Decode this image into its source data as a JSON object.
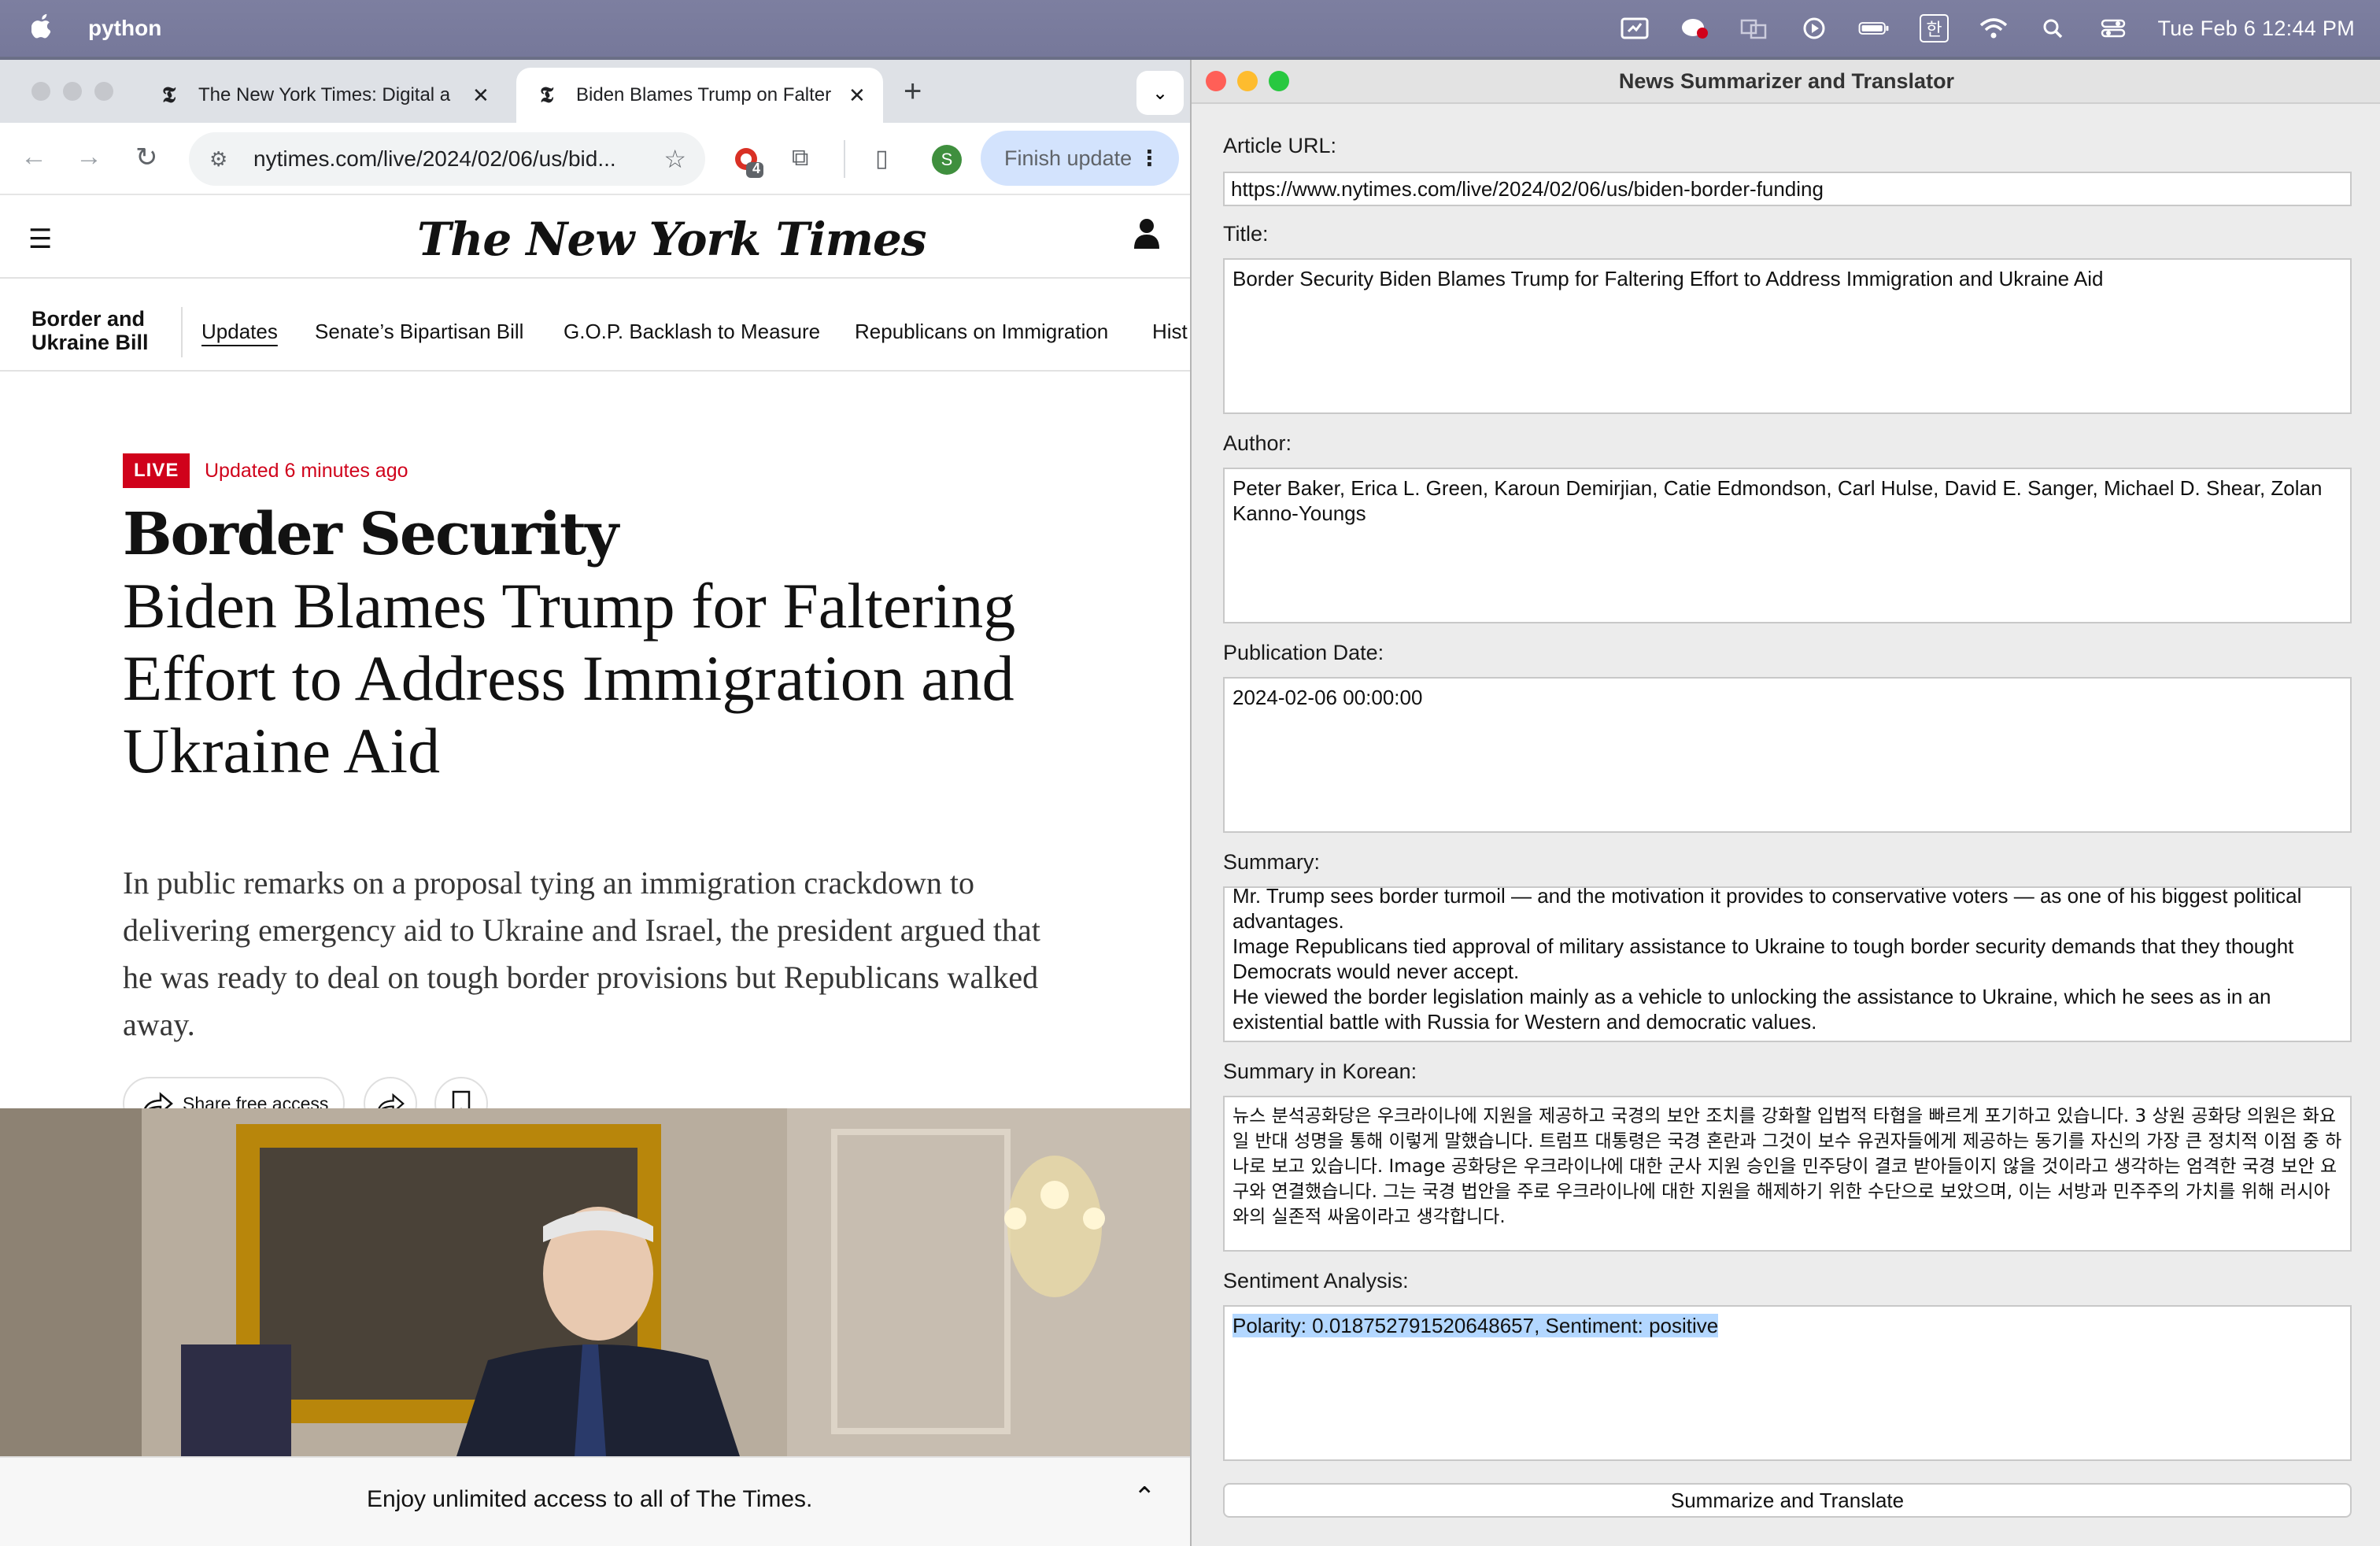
{
  "menubar": {
    "app_name": "python",
    "clock": "Tue Feb 6  12:44 PM",
    "input_source": "한"
  },
  "browser": {
    "tabs": [
      {
        "title": "The New York Times: Digital a",
        "favicon": "𝕿"
      },
      {
        "title": "Biden Blames Trump on Falter",
        "favicon": "𝕿"
      }
    ],
    "url": "nytimes.com/live/2024/02/06/us/bid...",
    "extension_badge": "4",
    "profile_initial": "S",
    "finish_update_label": "Finish update"
  },
  "nyt": {
    "logo": "The New York Times",
    "section": "Border and Ukraine Bill",
    "subnav": [
      "Updates",
      "Senate’s Bipartisan Bill",
      "G.O.P. Backlash to Measure",
      "Republicans on Immigration",
      "Hist"
    ],
    "live_label": "LIVE",
    "updated": "Updated 6 minutes ago",
    "kicker": "Border Security",
    "headline": "Biden Blames Trump for Faltering Effort to Address Immigration and Ukraine Aid",
    "dek": "In public remarks on a proposal tying an immigration crackdown to delivering emergency aid to Ukraine and Israel, the president argued that he was ready to deal on tough border provisions but Republicans walked away.",
    "share_free_label": "Share free access",
    "paywall_text": "Enjoy unlimited access to all of The Times."
  },
  "app": {
    "window_title": "News Summarizer and Translator",
    "url_label": "Article URL:",
    "url_value": "https://www.nytimes.com/live/2024/02/06/us/biden-border-funding",
    "title_label": "Title:",
    "title_value": "Border Security Biden Blames Trump for Faltering Effort to Address Immigration and Ukraine Aid",
    "author_label": "Author:",
    "author_value": "Peter Baker, Erica L. Green, Karoun Demirjian, Catie Edmondson, Carl Hulse, David E. Sanger, Michael D. Shear, Zolan Kanno-Youngs",
    "date_label": "Publication Date:",
    "date_value": "2024-02-06 00:00:00",
    "summary_label": "Summary:",
    "summary_lines": [
      "Mr. Trump sees border turmoil — and the motivation it provides to conservative voters — as one of his biggest political advantages.",
      "Image Republicans tied approval of military assistance to Ukraine to tough border security demands that they thought Democrats would never accept.",
      "He viewed the border legislation mainly as a vehicle to unlocking the assistance to Ukraine, which he sees as in an existential battle with Russia for Western and democratic values."
    ],
    "korean_label": "Summary in Korean:",
    "korean_value": "뉴스 분석공화당은 우크라이나에 지원을 제공하고 국경의 보안 조치를 강화할 입법적 타협을 빠르게 포기하고 있습니다. 3 상원 공화당 의원은 화요일 반대 성명을 통해 이렇게 말했습니다. 트럼프 대통령은 국경 혼란과 그것이 보수 유권자들에게 제공하는 동기를 자신의 가장 큰 정치적 이점 중 하나로 보고 있습니다. Image 공화당은 우크라이나에 대한 군사 지원 승인을 민주당이 결코 받아들이지 않을 것이라고 생각하는 엄격한 국경 보안 요구와 연결했습니다. 그는 국경 법안을 주로 우크라이나에 대한 지원을 해제하기 위한 수단으로 보았으며, 이는 서방과 민주주의 가치를 위해 러시아와의 실존적 싸움이라고 생각합니다.",
    "sentiment_label": "Sentiment Analysis:",
    "sentiment_value": "Polarity: 0.018752791520648657, Sentiment: positive",
    "button_label": "Summarize and Translate"
  }
}
